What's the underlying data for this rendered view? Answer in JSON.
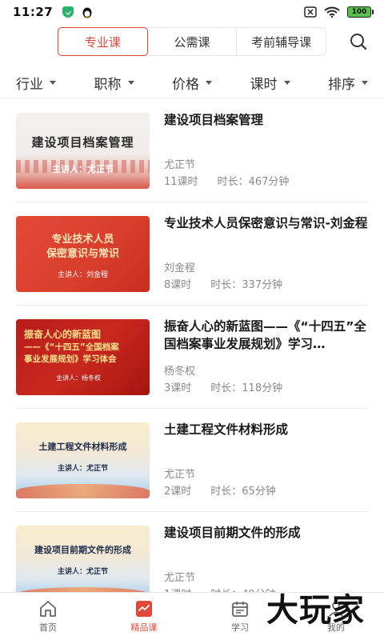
{
  "status_bar": {
    "time": "11:27",
    "battery": "100"
  },
  "tabs": [
    {
      "label": "专业课",
      "active": true
    },
    {
      "label": "公需课",
      "active": false
    },
    {
      "label": "考前辅导课",
      "active": false
    }
  ],
  "filters": [
    "行业",
    "职称",
    "价格",
    "课时",
    "排序"
  ],
  "courses": [
    {
      "title": "建设项目档案管理",
      "author": "尤正节",
      "lessons": "11课时",
      "duration": "时长：467分钟",
      "thumb_lines": [
        "建设项目档案管理",
        "主讲人：尤正节"
      ]
    },
    {
      "title": "专业技术人员保密意识与常识-刘金程",
      "author": "刘金程",
      "lessons": "8课时",
      "duration": "时长：337分钟",
      "thumb_lines": [
        "专业技术人员",
        "保密意识与常识",
        "主讲人：刘金程"
      ]
    },
    {
      "title": "振奋人心的新蓝图——《“十四五”全国档案事业发展规划》学习…",
      "author": "杨冬权",
      "lessons": "3课时",
      "duration": "时长：118分钟",
      "thumb_lines": [
        "振奋人心的新蓝图",
        "——《“十四五”全国档案",
        "事业发展规划》学习体会",
        "主讲人：杨冬权"
      ]
    },
    {
      "title": "土建工程文件材料形成",
      "author": "尤正节",
      "lessons": "2课时",
      "duration": "时长：65分钟",
      "thumb_lines": [
        "土建工程文件材料形成",
        "主讲人：尤正节"
      ]
    },
    {
      "title": "建设项目前期文件的形成",
      "author": "尤正节",
      "lessons": "1课时",
      "duration": "时长：49分钟",
      "thumb_lines": [
        "建设项目前期文件的形成",
        "主讲人：尤正节"
      ]
    }
  ],
  "bottom_nav": [
    {
      "label": "首页",
      "icon": "home-icon"
    },
    {
      "label": "精品课",
      "icon": "course-icon",
      "active": true
    },
    {
      "label": "学习",
      "icon": "calendar-icon"
    },
    {
      "label": "我的",
      "icon": "profile-icon"
    }
  ],
  "watermark": "大玩家",
  "colors": {
    "accent": "#e0493a",
    "text": "#1a1a1a",
    "muted": "#8a8a8a"
  }
}
